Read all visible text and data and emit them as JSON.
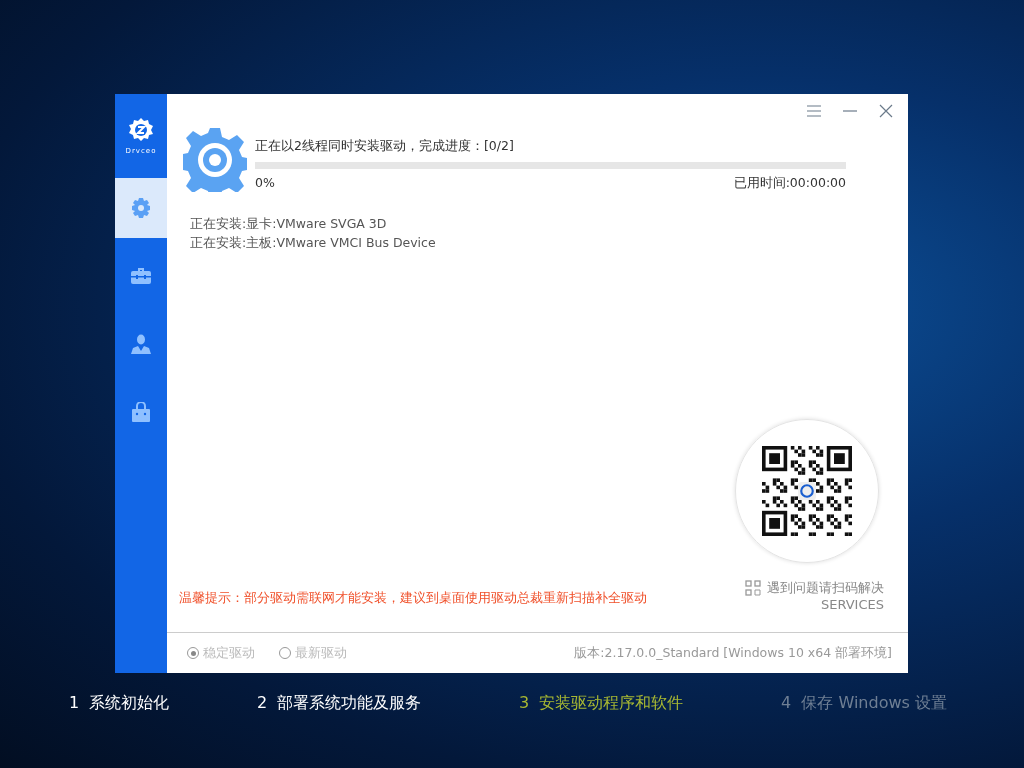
{
  "sidebar": {
    "logo": "Drvceo",
    "items": [
      {
        "kind": "gear",
        "selected": true
      },
      {
        "kind": "toolbox",
        "selected": false
      },
      {
        "kind": "person",
        "selected": false
      },
      {
        "kind": "bag",
        "selected": false
      }
    ]
  },
  "progress": {
    "title": "正在以2线程同时安装驱动，完成进度：[0/2]",
    "level": 0,
    "percent": "0%",
    "elapsed": "已用时间:00:00:00"
  },
  "installing": [
    "正在安装:显卡:VMware SVGA 3D",
    "正在安装:主板:VMware VMCI Bus Device"
  ],
  "tip": "温馨提示：部分驱动需联网才能安装，建议到桌面使用驱动总裁重新扫描补全驱动",
  "service": {
    "text": "遇到问题请扫码解决",
    "sub": "SERVICES"
  },
  "options": [
    {
      "label": "稳定驱动",
      "selected": true
    },
    {
      "label": "最新驱动",
      "selected": false
    }
  ],
  "version": "版本:2.17.0.0_Standard [Windows 10 x64 部署环境]",
  "steps": [
    {
      "num": "1",
      "label": "系统初始化",
      "done": true,
      "current": false
    },
    {
      "num": "2",
      "label": "部署系统功能及服务",
      "done": true,
      "current": false
    },
    {
      "num": "3",
      "label": "安装驱动程序和软件",
      "done": false,
      "current": true
    },
    {
      "num": "4",
      "label": "保存 Windows 设置",
      "done": false,
      "current": false
    }
  ]
}
